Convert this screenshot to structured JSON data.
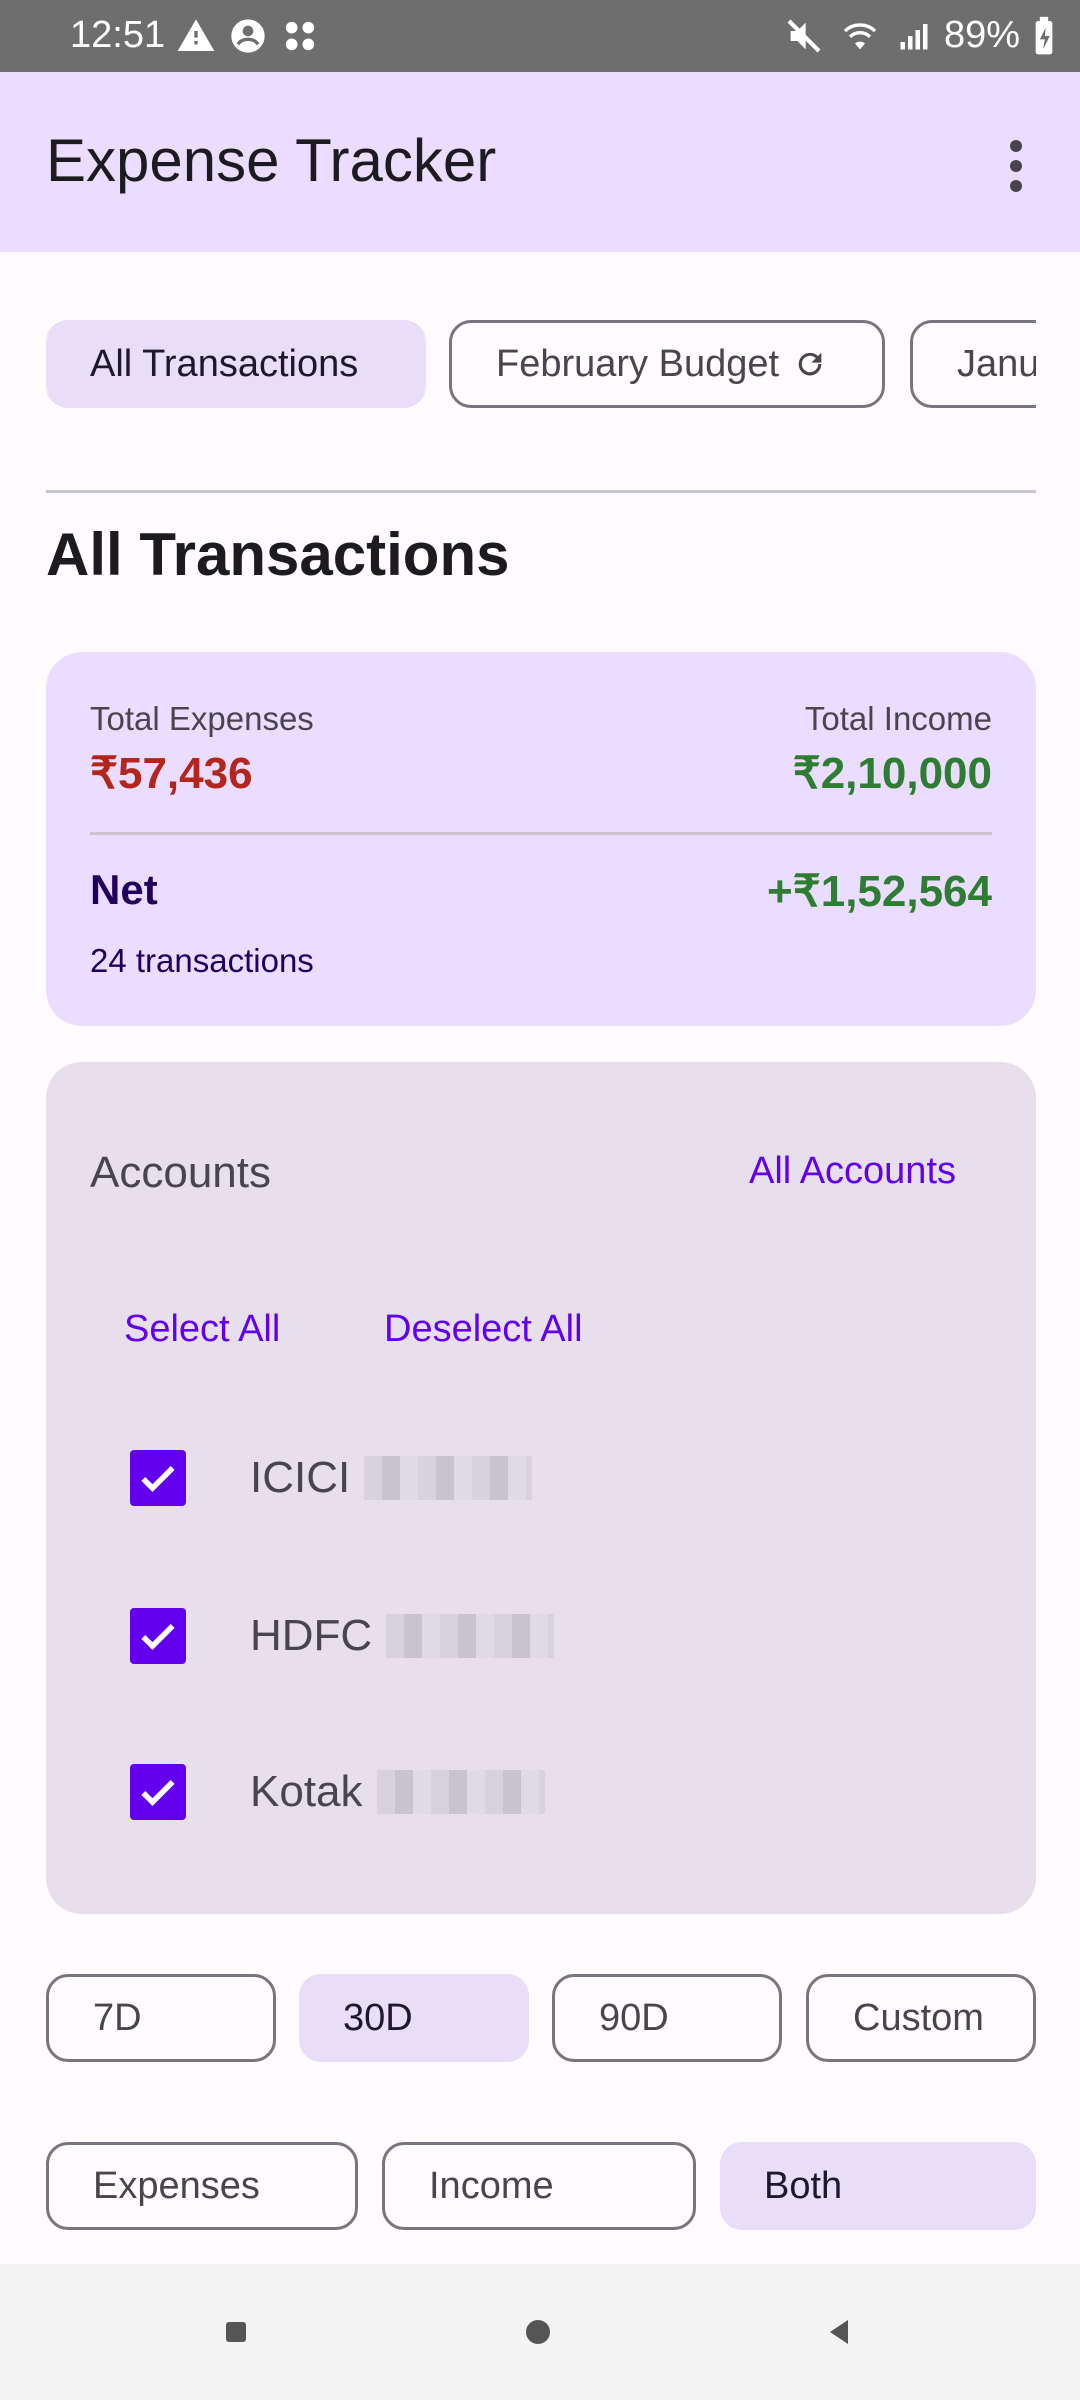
{
  "status_bar": {
    "time": "12:51",
    "battery": "89%"
  },
  "app_bar": {
    "title": "Expense Tracker",
    "menu_icon": "more-vert-icon"
  },
  "budget_chips": [
    {
      "label": "All Transactions",
      "selected": true
    },
    {
      "label": "February Budget",
      "selected": false,
      "icon": "refresh-icon"
    },
    {
      "label": "Janu",
      "selected": false
    }
  ],
  "section_title": "All Transactions",
  "summary": {
    "expenses_label": "Total Expenses",
    "expenses_value": "₹57,436",
    "income_label": "Total Income",
    "income_value": "₹2,10,000",
    "net_label": "Net",
    "net_value": "+₹1,52,564",
    "transactions_count": "24 transactions"
  },
  "accounts": {
    "title": "Accounts",
    "all_accounts_label": "All Accounts",
    "select_all_label": "Select All",
    "deselect_all_label": "Deselect All",
    "items": [
      {
        "name": "ICICI",
        "checked": true
      },
      {
        "name": "HDFC",
        "checked": true
      },
      {
        "name": "Kotak",
        "checked": true
      }
    ]
  },
  "range_buttons": [
    {
      "label": "7D",
      "selected": false
    },
    {
      "label": "30D",
      "selected": true
    },
    {
      "label": "90D",
      "selected": false
    },
    {
      "label": "Custom",
      "selected": false
    }
  ],
  "type_buttons": [
    {
      "label": "Expenses",
      "selected": false
    },
    {
      "label": "Income",
      "selected": false
    },
    {
      "label": "Both",
      "selected": true
    }
  ],
  "colors": {
    "accent": "#6200EE",
    "expense": "#B3261E",
    "income": "#2E7D32",
    "appbar": "#EADDFF"
  }
}
